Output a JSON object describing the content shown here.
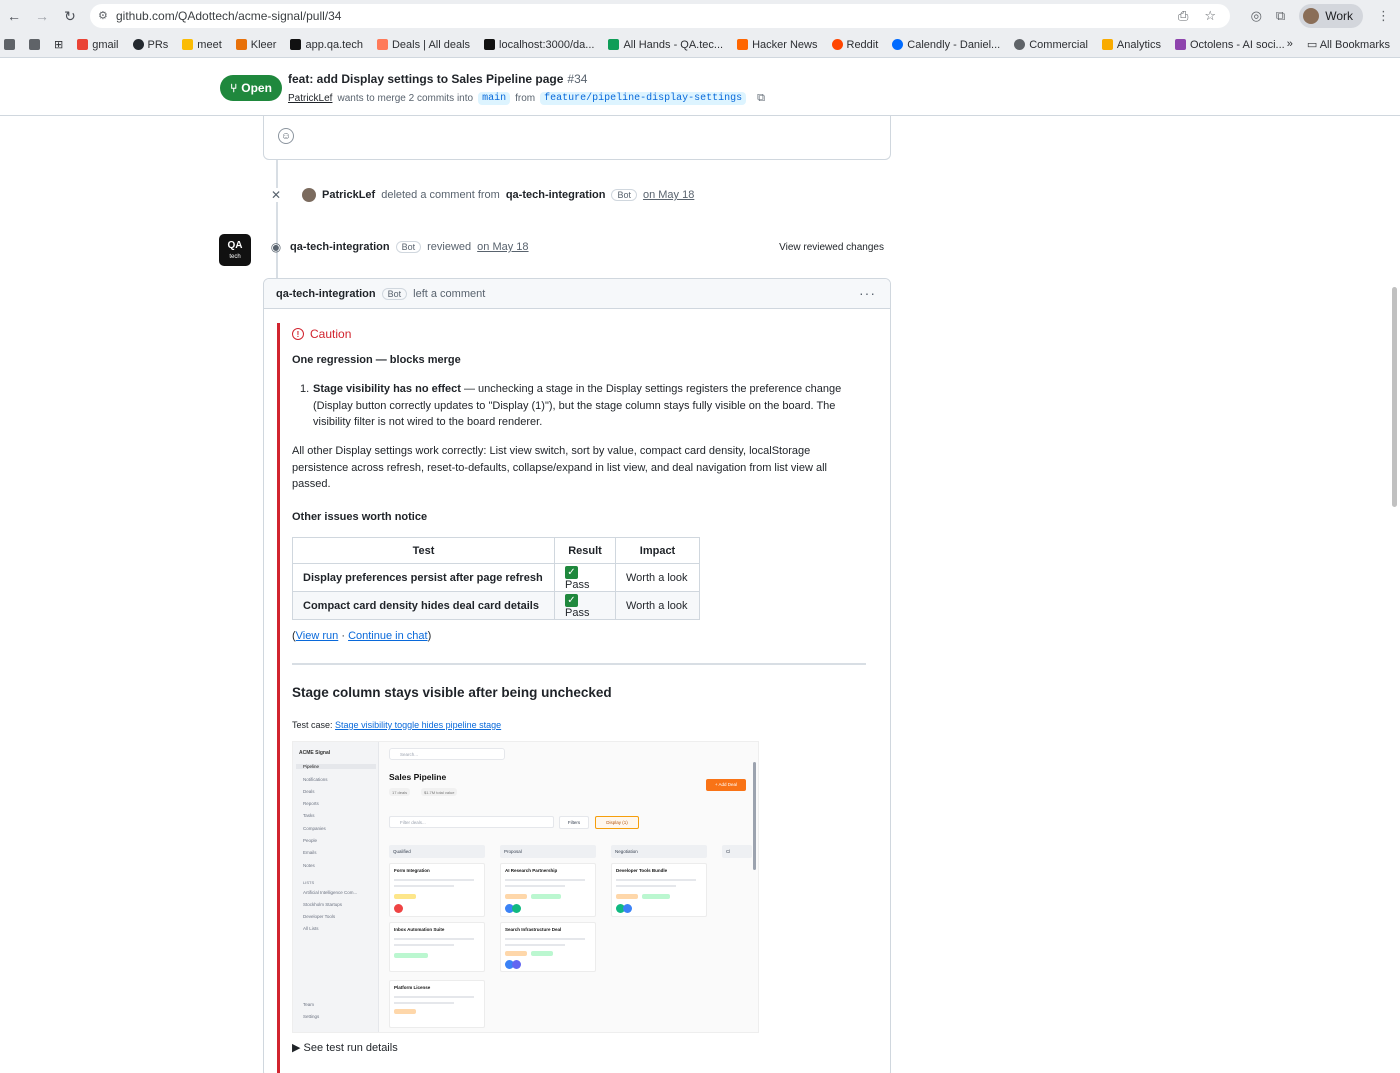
{
  "browser": {
    "url": "github.com/QAdottech/acme-signal/pull/34",
    "profile": "Work",
    "bookmarks": [
      "gmail",
      "PRs",
      "meet",
      "Kleer",
      "app.qa.tech",
      "Deals | All deals",
      "localhost:3000/da...",
      "All Hands - QA.tec...",
      "Hacker News",
      "Reddit",
      "Calendly - Daniel...",
      "Commercial",
      "Analytics",
      "Octolens - AI soci..."
    ],
    "all_bookmarks": "All Bookmarks"
  },
  "pr": {
    "state": "Open",
    "title": "feat: add Display settings to Sales Pipeline page",
    "number": "#34",
    "author": "PatrickLef",
    "merge_text": "wants to merge 2 commits into",
    "base_branch": "main",
    "from_text": "from",
    "head_branch": "feature/pipeline-display-settings"
  },
  "timeline": {
    "deleted_event": {
      "actor": "PatrickLef",
      "text": "deleted a comment from",
      "target": "qa-tech-integration",
      "bot": "Bot",
      "date": "on May 18"
    },
    "review_event": {
      "avatar_top": "QA",
      "avatar_bottom": "tech",
      "reviewer": "qa-tech-integration",
      "bot": "Bot",
      "text": "reviewed",
      "date": "on May 18",
      "view_changes": "View reviewed changes"
    }
  },
  "comment": {
    "author": "qa-tech-integration",
    "bot": "Bot",
    "action": "left a comment",
    "more": "···",
    "caution": "Caution",
    "regression_heading": "One regression — blocks merge",
    "item_number": "1.",
    "item_bold": "Stage visibility has no effect",
    "item_text": " — unchecking a stage in the Display settings registers the preference change (Display button correctly updates to \"Display (1)\"), but the stage column stays fully visible on the board. The visibility filter is not wired to the board renderer.",
    "other_paragraph": "All other Display settings work correctly: List view switch, sort by value, compact card density, localStorage persistence across refresh, reset-to-defaults, collapse/expand in list view, and deal navigation from list view all passed.",
    "other_issues_heading": "Other issues worth notice",
    "table": {
      "headers": [
        "Test",
        "Result",
        "Impact"
      ],
      "rows": [
        {
          "test": "Display preferences persist after page refresh",
          "result": "Pass",
          "impact": "Worth a look"
        },
        {
          "test": "Compact card density hides deal card details",
          "result": "Pass",
          "impact": "Worth a look"
        }
      ]
    },
    "links": {
      "open": "(",
      "view_run": "View run",
      "sep": " · ",
      "continue": "Continue in chat",
      "close": ")"
    },
    "section_title": "Stage column stays visible after being unchecked",
    "test_case_label": "Test case:",
    "test_case_link": "Stage visibility toggle hides pipeline stage",
    "details_toggle": "See test run details"
  },
  "screenshot": {
    "brand": "ACME Signal",
    "search": "Search...",
    "nav": [
      "Pipeline",
      "Notifications",
      "Deals",
      "Reports",
      "Tasks",
      "Companies",
      "People",
      "Emails",
      "Notes"
    ],
    "lists_label": "LISTS",
    "lists": [
      "Artificial Intelligence Com...",
      "Stockholm Startups",
      "Developer Tools",
      "All Lists"
    ],
    "footer_nav": [
      "Team",
      "Settings"
    ],
    "title": "Sales Pipeline",
    "chips": [
      "17 deals",
      "$1.7M total value"
    ],
    "add_deal": "+ Add Deal",
    "filter": "Filter deals...",
    "filters_btn": "Filters",
    "display_btn": "Display (1)",
    "columns": [
      "Qualified",
      "Proposal",
      "Negotiation",
      "Cl"
    ],
    "deals": [
      {
        "title": "Form Integration"
      },
      {
        "title": "AI Research Partnership"
      },
      {
        "title": "Developer Tools Bundle"
      },
      {
        "title": "Inbox Automation Suite"
      },
      {
        "title": "Search Infrastructure Deal"
      },
      {
        "title": "Platform License"
      }
    ]
  }
}
